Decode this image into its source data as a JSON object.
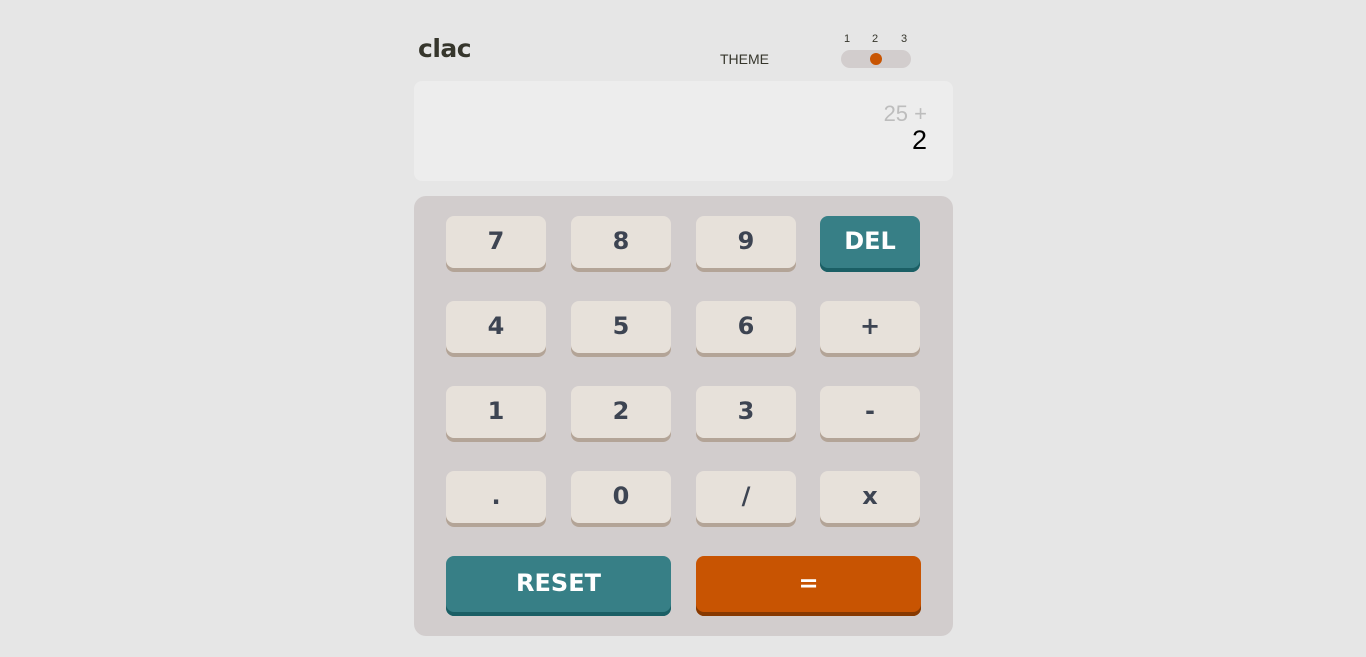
{
  "header": {
    "logo": "clac",
    "theme_label": "THEME",
    "theme_numbers": [
      "1",
      "2",
      "3"
    ],
    "theme_selected": 2
  },
  "screen": {
    "previous": "25 +",
    "current": "2"
  },
  "keypad": {
    "rows": [
      [
        {
          "label": "7",
          "name": "key-7",
          "kind": "num"
        },
        {
          "label": "8",
          "name": "key-8",
          "kind": "num"
        },
        {
          "label": "9",
          "name": "key-9",
          "kind": "num"
        },
        {
          "label": "DEL",
          "name": "delete-button",
          "kind": "accent"
        }
      ],
      [
        {
          "label": "4",
          "name": "key-4",
          "kind": "num"
        },
        {
          "label": "5",
          "name": "key-5",
          "kind": "num"
        },
        {
          "label": "6",
          "name": "key-6",
          "kind": "num"
        },
        {
          "label": "+",
          "name": "add-button",
          "kind": "num"
        }
      ],
      [
        {
          "label": "1",
          "name": "key-1",
          "kind": "num"
        },
        {
          "label": "2",
          "name": "key-2",
          "kind": "num"
        },
        {
          "label": "3",
          "name": "key-3",
          "kind": "num"
        },
        {
          "label": "-",
          "name": "subtract-button",
          "kind": "num"
        }
      ],
      [
        {
          "label": ".",
          "name": "decimal-button",
          "kind": "num"
        },
        {
          "label": "0",
          "name": "key-0",
          "kind": "num"
        },
        {
          "label": "/",
          "name": "divide-button",
          "kind": "num"
        },
        {
          "label": "x",
          "name": "multiply-button",
          "kind": "num"
        }
      ]
    ],
    "reset_label": "RESET",
    "equals_label": "="
  },
  "colors": {
    "page_background": "#e6e6e6",
    "keypad_background": "#d2cdcd",
    "screen_background": "#ededed",
    "key_background": "#e7e1da",
    "key_text": "#3d4452",
    "accent_key": "#377f86",
    "equals_key": "#c85402",
    "theme_knob": "#c85402"
  }
}
